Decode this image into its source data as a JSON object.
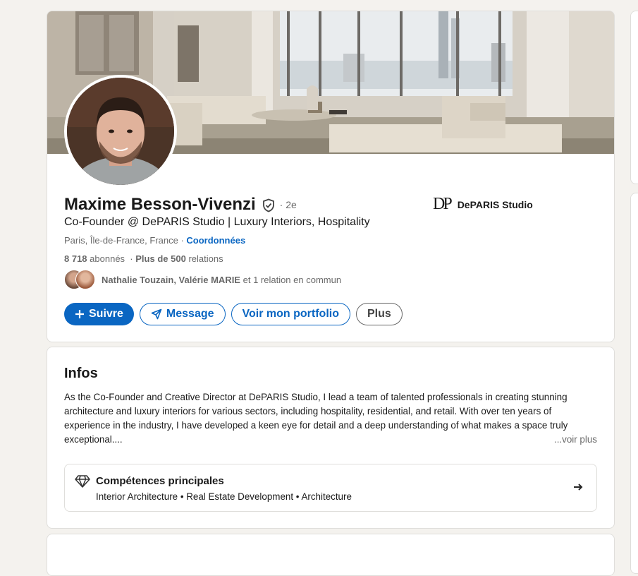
{
  "profile": {
    "name": "Maxime Besson-Vivenzi",
    "degree": "· 2e",
    "headline": "Co-Founder @ DePARIS Studio | Luxury Interiors, Hospitality",
    "location": "Paris, Île-de-France, France ·",
    "contact_link": "Coordonnées",
    "followers_count": "8 718",
    "followers_label": "abonnés",
    "connections_sep": "·",
    "connections_count": "Plus de 500",
    "connections_label": "relations",
    "mutual_names": "Nathalie Touzain, Valérie MARIE",
    "mutual_rest": "et 1 relation en commun",
    "company_logo_text": "DP",
    "company_name": "DePARIS Studio"
  },
  "actions": {
    "follow": "Suivre",
    "message": "Message",
    "portfolio": "Voir mon portfolio",
    "more": "Plus"
  },
  "infos": {
    "title": "Infos",
    "text": "As the Co-Founder and Creative Director at DePARIS Studio, I lead a team of talented professionals in creating stunning architecture and luxury interiors for various sectors, including hospitality, residential, and retail. With over ten years of experience in the industry, I have developed a keen eye for detail and a deep understanding of what makes a space truly exceptional....",
    "see_more": "...voir plus",
    "skills_title": "Compétences principales",
    "skills_list": "Interior Architecture • Real Estate Development • Architecture"
  },
  "colors": {
    "accent": "#0a66c2",
    "page_bg": "#f4f2ee",
    "card_border": "#dfdedb"
  },
  "icons": [
    "verified-shield-icon",
    "plus-icon",
    "send-icon",
    "diamond-icon",
    "arrow-right-icon"
  ]
}
